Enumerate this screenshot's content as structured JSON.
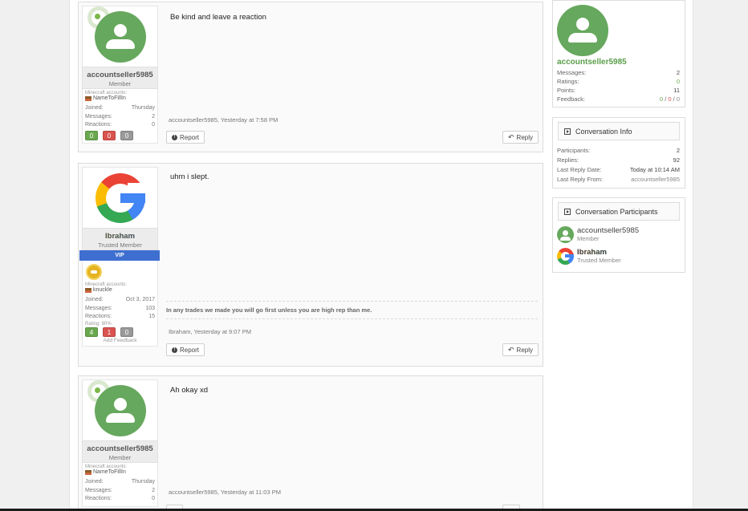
{
  "posts": [
    {
      "message": "Be kind and leave a reaction",
      "user": {
        "name": "accountseller5985",
        "title": "Member",
        "accounts_label": "Minecraft accounts:",
        "account": "NameToFillIn",
        "joined_label": "Joined:",
        "joined": "Thursday",
        "messages_label": "Messages:",
        "messages": "2",
        "reactions_label": "Reactions:",
        "reactions": "0",
        "feedback": [
          "0",
          "0",
          "0"
        ]
      },
      "meta": "accountseller5985, Yesterday at 7:58 PM",
      "report_label": "Report",
      "reply_label": "Reply"
    },
    {
      "message": "uhm i slept.",
      "user": {
        "name": "Ibraham",
        "title": "Trusted Member",
        "banner": "VIP",
        "accounts_label": "Minecraft accounts:",
        "account": "knuckle",
        "joined_label": "Joined:",
        "joined": "Oct 3, 2017",
        "messages_label": "Messages:",
        "messages": "103",
        "reactions_label": "Reactions:",
        "reactions": "15",
        "rating": "Rating: 80%",
        "feedback": [
          "4",
          "1",
          "0"
        ],
        "add_feedback": "Add Feedback"
      },
      "signature": "In any trades we made you will go first unless you are high rep than me.",
      "meta": "Ibraham, Yesterday at 9:07 PM",
      "report_label": "Report",
      "reply_label": "Reply"
    },
    {
      "message": "Ah okay xd",
      "user": {
        "name": "accountseller5985",
        "title": "Member",
        "accounts_label": "Minecraft accounts:",
        "account": "NameToFillIn",
        "joined_label": "Joined:",
        "joined": "Thursday",
        "messages_label": "Messages:",
        "messages": "2",
        "reactions_label": "Reactions:",
        "reactions": "0"
      },
      "meta": "accountseller5985, Yesterday at 11:03 PM"
    }
  ],
  "sidebar": {
    "user": {
      "name": "accountseller5985",
      "messages_label": "Messages:",
      "messages": "2",
      "ratings_label": "Ratings:",
      "ratings": "0",
      "points_label": "Points:",
      "points": "11",
      "feedback_label": "Feedback:",
      "fb_pos": "0",
      "fb_neg": "0",
      "fb_neu": "0",
      "sep": "/"
    },
    "conversation_info": {
      "title": "Conversation Info",
      "participants_label": "Participants:",
      "participants": "2",
      "replies_label": "Replies:",
      "replies": "92",
      "last_reply_date_label": "Last Reply Date:",
      "last_reply_date": "Today at 10:14 AM",
      "last_reply_from_label": "Last Reply From:",
      "last_reply_from": "accountseller5985"
    },
    "participants": {
      "title": "Conversation Participants",
      "list": [
        {
          "name": "accountseller5985",
          "title": "Member"
        },
        {
          "name": "Ibraham",
          "title": "Trusted Member"
        }
      ]
    }
  },
  "colors": {
    "accent_green": "#5a9e4a",
    "vip_blue": "#3e6fd0",
    "positive": "#6aa84f",
    "negative": "#d9534f"
  },
  "icons": [
    "default-avatar-icon",
    "google-logo-icon",
    "info-icon",
    "reply-icon",
    "conversation-icon",
    "trade-badge-icon",
    "flag-icon"
  ]
}
